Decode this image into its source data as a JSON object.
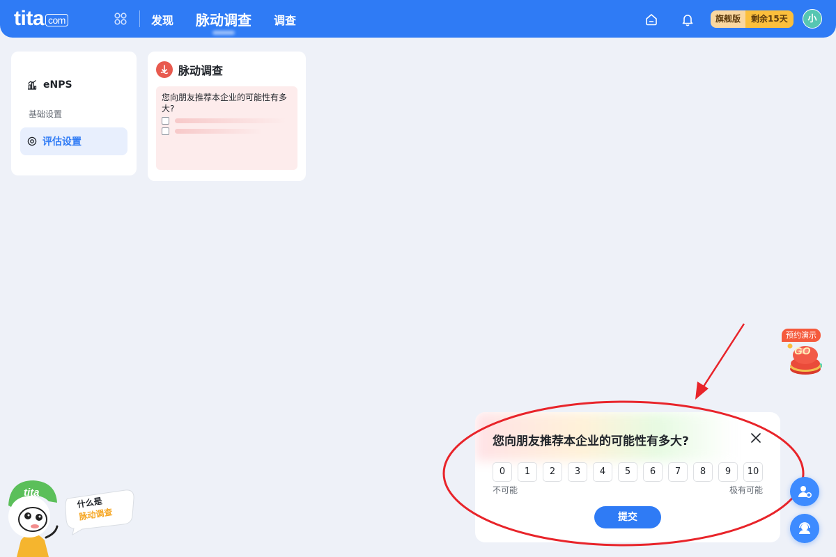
{
  "topbar": {
    "logo_text": "tita",
    "logo_suffix": "com",
    "nav": [
      {
        "label": "发现"
      },
      {
        "label": "脉动调查"
      },
      {
        "label": "调查"
      }
    ],
    "plan_badge": "旗舰版",
    "trial_badge": "剩余15天",
    "avatar_text": "小"
  },
  "sidebar": {
    "header": "eNPS",
    "section_label": "基础设置",
    "active_item": "评估设置"
  },
  "pulse_card": {
    "title": "脉动调查",
    "preview_question": "您向朋友推荐本企业的可能性有多大?"
  },
  "survey": {
    "question": "您向朋友推荐本企业的可能性有多大?",
    "scale": [
      "0",
      "1",
      "2",
      "3",
      "4",
      "5",
      "6",
      "7",
      "8",
      "9",
      "10"
    ],
    "low_label": "不可能",
    "high_label": "极有可能",
    "submit_label": "提交"
  },
  "floating": {
    "demo_tag": "预约演示",
    "demo_button_text": "GO"
  },
  "mascot": {
    "brand_text": "tita",
    "bubble_line1": "什么是",
    "bubble_line2": "脉动调查"
  },
  "colors": {
    "primary": "#2f7bf5",
    "page_bg": "#eef1f8",
    "annotation_red": "#e8242a",
    "badge_gold": "#fbbf3c"
  }
}
